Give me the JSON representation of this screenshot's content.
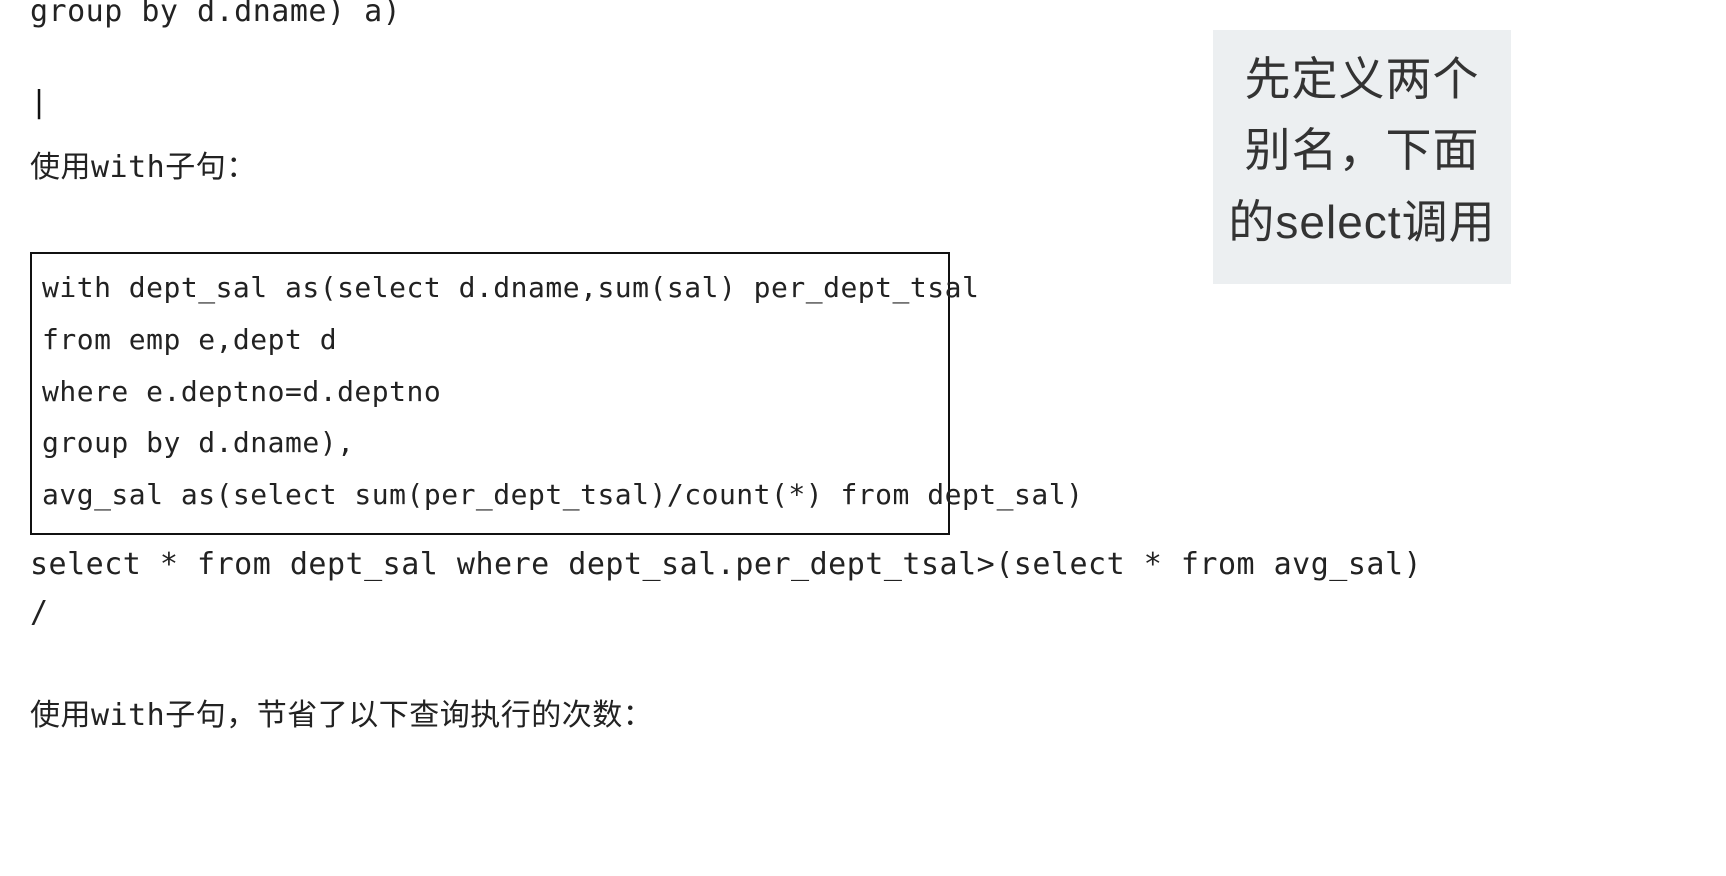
{
  "content": {
    "truncatedTop": "group by d.dname) a)",
    "cursor": "|",
    "heading1": "使用with子句：",
    "codeBoxLines": [
      "with dept_sal as(select d.dname,sum(sal) per_dept_tsal",
      "from emp e,dept d",
      "where e.deptno=d.deptno",
      "group by d.dname),",
      "avg_sal as(select sum(per_dept_tsal)/count(*) from dept_sal)"
    ],
    "afterBoxLines": [
      "select * from dept_sal where dept_sal.per_dept_tsal>(select * from avg_sal)",
      "/"
    ],
    "heading2": "使用with子句，节省了以下查询执行的次数："
  },
  "callout": {
    "text": "先定义两个别名，下面的select调用"
  }
}
